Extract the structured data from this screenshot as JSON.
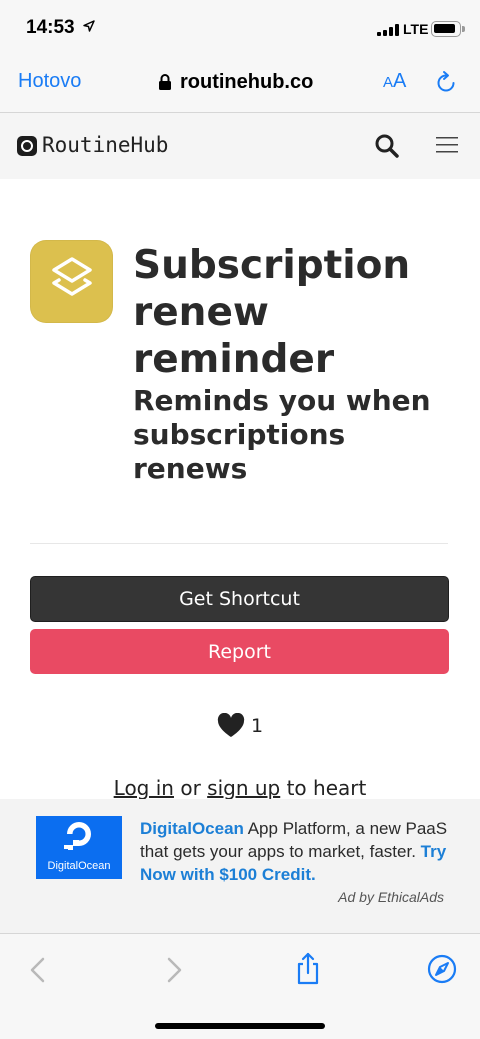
{
  "status_bar": {
    "time": "14:53",
    "network": "LTE",
    "icons": [
      "location-arrow-icon",
      "signal-icon",
      "battery-icon"
    ]
  },
  "browser": {
    "done_label": "Hotovo",
    "url": "routinehub.co",
    "text_size_small": "A",
    "text_size_big": "A",
    "icons": [
      "lock-icon",
      "reload-icon"
    ]
  },
  "site": {
    "name": "RoutineHub",
    "icons": [
      "routinehub-logo-icon",
      "search-icon",
      "hamburger-menu-icon"
    ]
  },
  "shortcut": {
    "title": "Subscription renew reminder",
    "subtitle": "Reminds you when subscriptions renews",
    "icon_color": "#dcc04e",
    "get_label": "Get Shortcut",
    "report_label": "Report",
    "heart_count": "1"
  },
  "login_prompt": {
    "login_link": "Log in",
    "or": "or",
    "signup_link": "sign up",
    "suffix": "to heart"
  },
  "ad": {
    "logo_text": "DigitalOcean",
    "brand": "DigitalOcean",
    "body": "App Platform, a new PaaS that gets your apps to market, faster.",
    "cta": "Try Now with $100 Credit.",
    "credit": "Ad by EthicalAds"
  },
  "colors": {
    "accent": "#1a7cf5",
    "get_button": "#353535",
    "report_button": "#e94a63",
    "ad_brand": "#1c7fd6"
  }
}
